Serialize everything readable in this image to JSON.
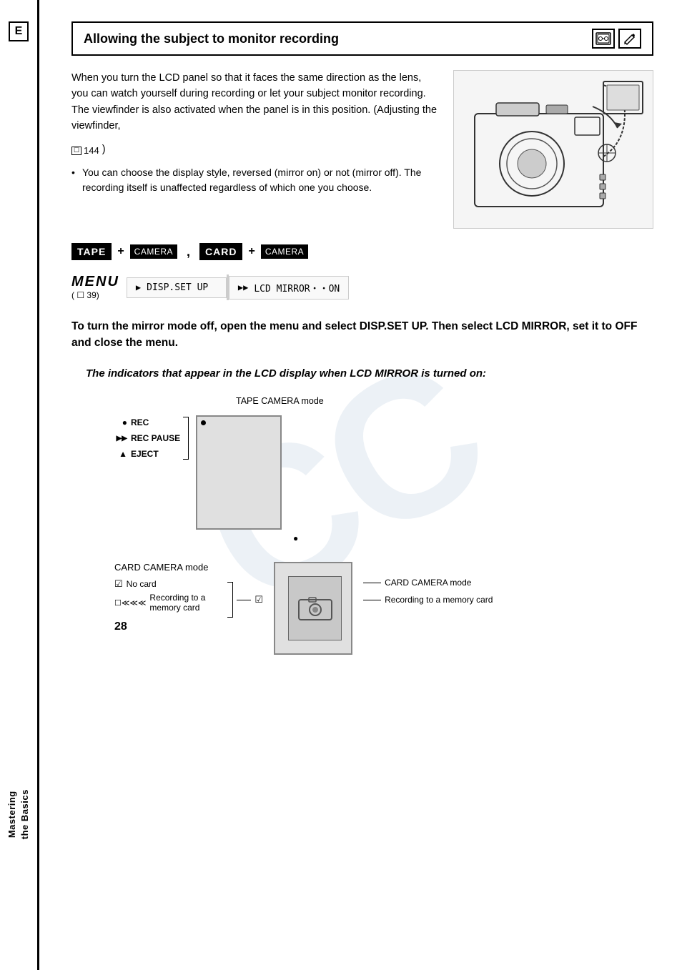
{
  "page": {
    "number": "28",
    "label_e": "E",
    "watermark": "CC"
  },
  "sidebar": {
    "label_e": "E",
    "rotated_text_line1": "Mastering",
    "rotated_text_line2": "the Basics"
  },
  "header": {
    "title": "Allowing the subject to monitor recording",
    "icon1": "📷",
    "icon2": "✏️"
  },
  "intro_text": "When you turn the LCD panel so that it faces the same direction as the lens, you can watch yourself during recording or let your subject monitor recording. The viewfinder is also activated when the panel is in this position. (Adjusting the viewfinder,",
  "ref_number": "144",
  "bullet_text": "You can choose the display style, reversed (mirror on) or not (mirror off). The recording itself is unaffected regardless of which one you choose.",
  "mode_buttons": {
    "tape_label": "TAPE",
    "plus1": "+",
    "camera1_label": "CAMERA",
    "comma": ",",
    "card_label": "CARD",
    "plus2": "+",
    "camera2_label": "CAMERA"
  },
  "menu_section": {
    "label": "MENU",
    "ref": "( ☐ 39)",
    "step1_arrow": "▶",
    "step1_text": "DISP.SET UP",
    "step2_arrow": "▶▶",
    "step2_text": "LCD MIRROR・・ON"
  },
  "bold_instruction": "To turn the mirror mode off, open the menu and select DISP.SET UP. Then select LCD MIRROR, set it to OFF and close the menu.",
  "italic_instruction": "The indicators that appear in the LCD display when LCD MIRROR is turned on:",
  "tape_camera_mode": {
    "label": "TAPE CAMERA mode",
    "indicators": [
      {
        "symbol": "●",
        "text": "REC"
      },
      {
        "symbol": "▶▶",
        "text": "REC PAUSE"
      },
      {
        "symbol": "▲",
        "text": "EJECT"
      }
    ]
  },
  "card_camera_mode": {
    "label": "CARD CAMERA mode",
    "indicators": [
      {
        "symbol": "☑",
        "text": "No card"
      },
      {
        "symbol": "☐≪≪≪",
        "text": "Recording to a memory card"
      }
    ]
  },
  "card_camera_mode_right": {
    "label1": "CARD CAMERA mode",
    "label2": "Recording to a memory card"
  }
}
